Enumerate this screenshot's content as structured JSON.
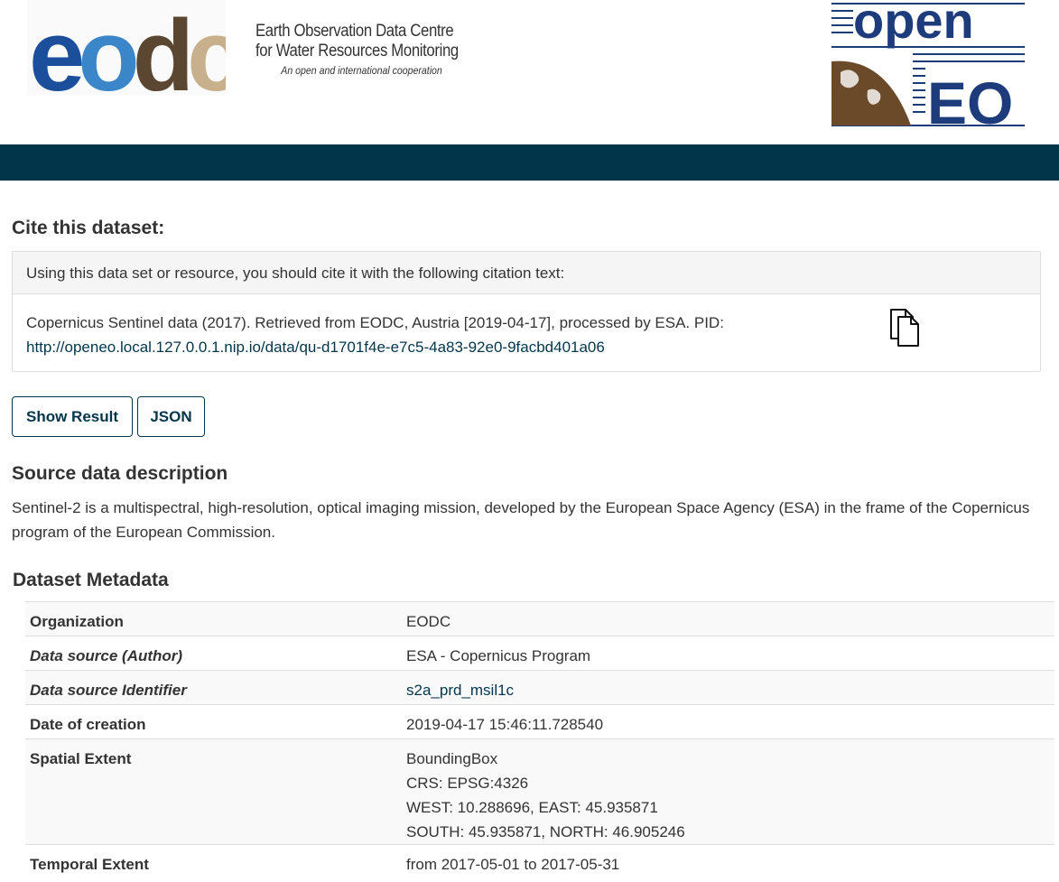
{
  "header": {
    "eodc_logo_text": "eodc",
    "eodc_line1": "Earth Observation Data Centre",
    "eodc_line2": "for Water Resources Monitoring",
    "eodc_subline": "An open and international cooperation",
    "openeo_logo_top": "open",
    "openeo_logo_bottom": "EO"
  },
  "cite": {
    "title": "Cite this dataset:",
    "instruction": "Using this data set or resource, you should cite it with the following citation text:",
    "citation_text": "Copernicus Sentinel data (2017). Retrieved from EODC, Austria [2019-04-17], processed by ESA. PID:",
    "citation_link": "http://openeo.local.127.0.0.1.nip.io/data/qu-d1701f4e-e7c5-4a83-92e0-9facbd401a06",
    "copy_icon": "copy-icon"
  },
  "buttons": {
    "show_result": "Show Result",
    "json": "JSON"
  },
  "source": {
    "title": "Source data description",
    "description": "Sentinel-2 is a multispectral, high-resolution, optical imaging mission, developed by the European Space Agency (ESA) in the frame of the Copernicus program of the European Commission."
  },
  "metadata": {
    "title": "Dataset Metadata",
    "rows": [
      {
        "key": "Organization",
        "value": "EODC"
      },
      {
        "key": "Data source (Author)",
        "value": "ESA - Copernicus Program"
      },
      {
        "key": "Data source Identifier",
        "value": "s2a_prd_msil1c"
      },
      {
        "key": "Date of creation",
        "value": "2019-04-17 15:46:11.728540"
      },
      {
        "key": "Spatial Extent",
        "lines": [
          "BoundingBox",
          "CRS: EPSG:4326",
          "WEST: 10.288696, EAST: 45.935871",
          "SOUTH: 45.935871, NORTH: 46.905246"
        ]
      },
      {
        "key": "Temporal Extent",
        "value": "from 2017-05-01 to 2017-05-31"
      }
    ]
  },
  "colors": {
    "banner": "#03354a",
    "link": "#03354a",
    "eodc_blue_dark": "#1b4f9c",
    "eodc_blue_light": "#3a86c8",
    "eodc_brown": "#5a4631",
    "eodc_tan": "#c8b08c",
    "openeo_blue": "#1e3c7c",
    "openeo_brown": "#6b4a2a"
  }
}
